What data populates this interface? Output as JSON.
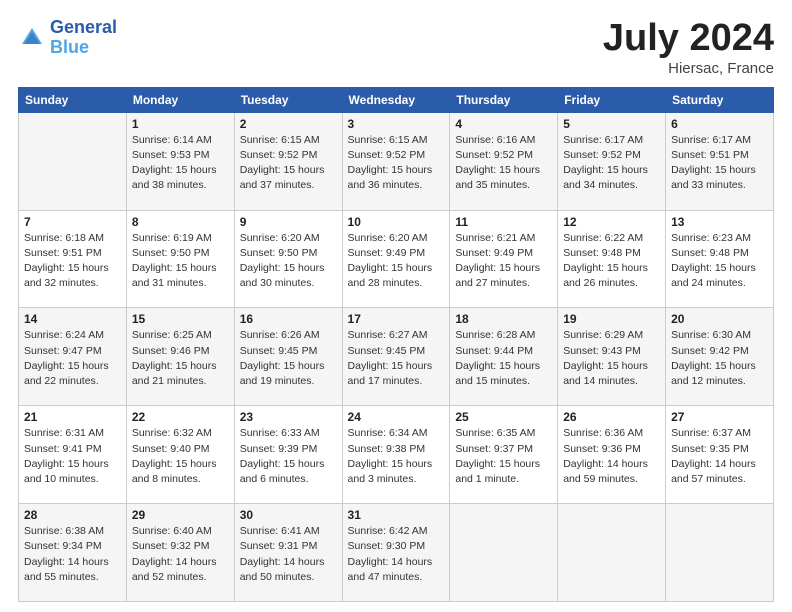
{
  "header": {
    "logo_line1": "General",
    "logo_line2": "Blue",
    "main_title": "July 2024",
    "subtitle": "Hiersac, France"
  },
  "calendar": {
    "days_of_week": [
      "Sunday",
      "Monday",
      "Tuesday",
      "Wednesday",
      "Thursday",
      "Friday",
      "Saturday"
    ],
    "weeks": [
      [
        {
          "num": "",
          "info": ""
        },
        {
          "num": "1",
          "info": "Sunrise: 6:14 AM\nSunset: 9:53 PM\nDaylight: 15 hours\nand 38 minutes."
        },
        {
          "num": "2",
          "info": "Sunrise: 6:15 AM\nSunset: 9:52 PM\nDaylight: 15 hours\nand 37 minutes."
        },
        {
          "num": "3",
          "info": "Sunrise: 6:15 AM\nSunset: 9:52 PM\nDaylight: 15 hours\nand 36 minutes."
        },
        {
          "num": "4",
          "info": "Sunrise: 6:16 AM\nSunset: 9:52 PM\nDaylight: 15 hours\nand 35 minutes."
        },
        {
          "num": "5",
          "info": "Sunrise: 6:17 AM\nSunset: 9:52 PM\nDaylight: 15 hours\nand 34 minutes."
        },
        {
          "num": "6",
          "info": "Sunrise: 6:17 AM\nSunset: 9:51 PM\nDaylight: 15 hours\nand 33 minutes."
        }
      ],
      [
        {
          "num": "7",
          "info": "Sunrise: 6:18 AM\nSunset: 9:51 PM\nDaylight: 15 hours\nand 32 minutes."
        },
        {
          "num": "8",
          "info": "Sunrise: 6:19 AM\nSunset: 9:50 PM\nDaylight: 15 hours\nand 31 minutes."
        },
        {
          "num": "9",
          "info": "Sunrise: 6:20 AM\nSunset: 9:50 PM\nDaylight: 15 hours\nand 30 minutes."
        },
        {
          "num": "10",
          "info": "Sunrise: 6:20 AM\nSunset: 9:49 PM\nDaylight: 15 hours\nand 28 minutes."
        },
        {
          "num": "11",
          "info": "Sunrise: 6:21 AM\nSunset: 9:49 PM\nDaylight: 15 hours\nand 27 minutes."
        },
        {
          "num": "12",
          "info": "Sunrise: 6:22 AM\nSunset: 9:48 PM\nDaylight: 15 hours\nand 26 minutes."
        },
        {
          "num": "13",
          "info": "Sunrise: 6:23 AM\nSunset: 9:48 PM\nDaylight: 15 hours\nand 24 minutes."
        }
      ],
      [
        {
          "num": "14",
          "info": "Sunrise: 6:24 AM\nSunset: 9:47 PM\nDaylight: 15 hours\nand 22 minutes."
        },
        {
          "num": "15",
          "info": "Sunrise: 6:25 AM\nSunset: 9:46 PM\nDaylight: 15 hours\nand 21 minutes."
        },
        {
          "num": "16",
          "info": "Sunrise: 6:26 AM\nSunset: 9:45 PM\nDaylight: 15 hours\nand 19 minutes."
        },
        {
          "num": "17",
          "info": "Sunrise: 6:27 AM\nSunset: 9:45 PM\nDaylight: 15 hours\nand 17 minutes."
        },
        {
          "num": "18",
          "info": "Sunrise: 6:28 AM\nSunset: 9:44 PM\nDaylight: 15 hours\nand 15 minutes."
        },
        {
          "num": "19",
          "info": "Sunrise: 6:29 AM\nSunset: 9:43 PM\nDaylight: 15 hours\nand 14 minutes."
        },
        {
          "num": "20",
          "info": "Sunrise: 6:30 AM\nSunset: 9:42 PM\nDaylight: 15 hours\nand 12 minutes."
        }
      ],
      [
        {
          "num": "21",
          "info": "Sunrise: 6:31 AM\nSunset: 9:41 PM\nDaylight: 15 hours\nand 10 minutes."
        },
        {
          "num": "22",
          "info": "Sunrise: 6:32 AM\nSunset: 9:40 PM\nDaylight: 15 hours\nand 8 minutes."
        },
        {
          "num": "23",
          "info": "Sunrise: 6:33 AM\nSunset: 9:39 PM\nDaylight: 15 hours\nand 6 minutes."
        },
        {
          "num": "24",
          "info": "Sunrise: 6:34 AM\nSunset: 9:38 PM\nDaylight: 15 hours\nand 3 minutes."
        },
        {
          "num": "25",
          "info": "Sunrise: 6:35 AM\nSunset: 9:37 PM\nDaylight: 15 hours\nand 1 minute."
        },
        {
          "num": "26",
          "info": "Sunrise: 6:36 AM\nSunset: 9:36 PM\nDaylight: 14 hours\nand 59 minutes."
        },
        {
          "num": "27",
          "info": "Sunrise: 6:37 AM\nSunset: 9:35 PM\nDaylight: 14 hours\nand 57 minutes."
        }
      ],
      [
        {
          "num": "28",
          "info": "Sunrise: 6:38 AM\nSunset: 9:34 PM\nDaylight: 14 hours\nand 55 minutes."
        },
        {
          "num": "29",
          "info": "Sunrise: 6:40 AM\nSunset: 9:32 PM\nDaylight: 14 hours\nand 52 minutes."
        },
        {
          "num": "30",
          "info": "Sunrise: 6:41 AM\nSunset: 9:31 PM\nDaylight: 14 hours\nand 50 minutes."
        },
        {
          "num": "31",
          "info": "Sunrise: 6:42 AM\nSunset: 9:30 PM\nDaylight: 14 hours\nand 47 minutes."
        },
        {
          "num": "",
          "info": ""
        },
        {
          "num": "",
          "info": ""
        },
        {
          "num": "",
          "info": ""
        }
      ]
    ]
  }
}
